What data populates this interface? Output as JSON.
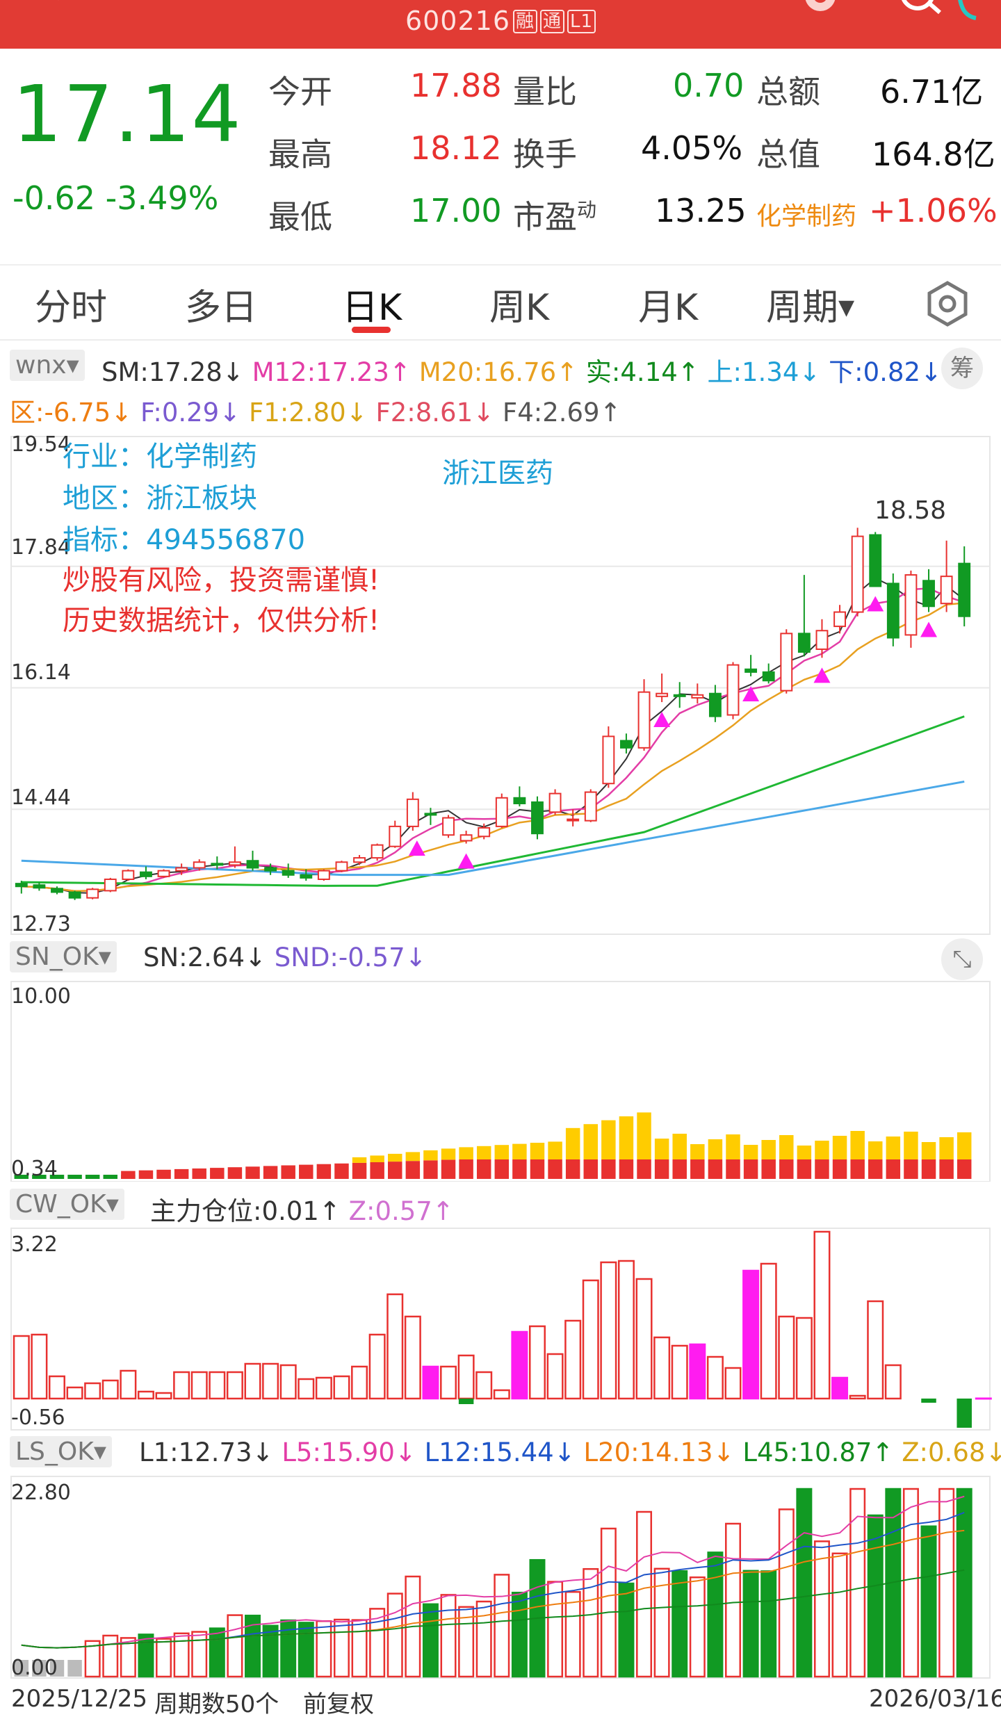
{
  "header": {
    "code": "600216",
    "tag1": "融",
    "tag2": "通",
    "tag3": "L1"
  },
  "quote": {
    "price": "17.14",
    "change": "-0.62",
    "change_pct": "-3.49%",
    "open_label": "今开",
    "open": "17.88",
    "high_label": "最高",
    "high": "18.12",
    "low_label": "最低",
    "low": "17.00",
    "vr_label": "量比",
    "vr": "0.70",
    "turn_label": "换手",
    "turn": "4.05%",
    "pe_label": "市盈",
    "pe_sup": "动",
    "pe": "13.25",
    "amt_label": "总额",
    "amt": "6.71亿",
    "cap_label": "总值",
    "cap": "164.8亿",
    "sector": "化学制药",
    "sector_pct": "+1.06%"
  },
  "tabs": [
    "分时",
    "多日",
    "日K",
    "周K",
    "月K",
    "周期"
  ],
  "active_tab": 2,
  "main_panel": {
    "name": "wnx",
    "chip": "筹",
    "line1": [
      "SM:17.28↓",
      "M12:17.23↑",
      "M20:16.76↑",
      "实:4.14↑",
      "上:1.34↓",
      "下:0.82↓"
    ],
    "line2": [
      "区:-6.75↓",
      "F:0.29↓",
      "F1:2.80↓",
      "F2:8.61↓",
      "F4:2.69↑"
    ],
    "axis": [
      "19.54",
      "17.84",
      "16.14",
      "14.44",
      "12.73"
    ],
    "ann_industry": "行业：化学制药",
    "ann_region": "地区：浙江板块",
    "ann_index": "指标：494556870",
    "ann_warn1": "炒股有风险，投资需谨慎!",
    "ann_warn2": "历史数据统计，仅供分析!",
    "ann_concept": "浙江医药",
    "high_label": "18.58"
  },
  "sn_panel": {
    "name": "SN_OK",
    "line": [
      "SN:2.64↓",
      "SND:-0.57↓"
    ],
    "axis_top": "10.00",
    "axis_bot": "0.34"
  },
  "cw_panel": {
    "name": "CW_OK",
    "line": [
      "主力仓位:0.01↑",
      "Z:0.57↑"
    ],
    "axis_top": "3.22",
    "axis_bot": "-0.56"
  },
  "ls_panel": {
    "name": "LS_OK",
    "line": [
      "L1:12.73↓",
      "L5:15.90↓",
      "L12:15.44↓",
      "L20:14.13↓",
      "L45:10.87↑",
      "Z:0.68↓"
    ],
    "axis_top": "22.80",
    "axis_bot": "0.00"
  },
  "footer": {
    "start_date": "2025/12/25",
    "period_count": "周期数50个",
    "adjust": "前复权",
    "end_date": "2026/03/16"
  },
  "colors": {
    "up": "#e8312f",
    "down": "#119a23",
    "header": "#e13b34",
    "magenta": "#ff1cf0",
    "gold": "#ffcc00"
  },
  "chart_data": {
    "type": "candlestick",
    "ylim": [
      12.73,
      19.54
    ],
    "candles": [
      [
        13.4,
        13.44,
        13.26,
        13.36
      ],
      [
        13.38,
        13.42,
        13.3,
        13.34
      ],
      [
        13.33,
        13.36,
        13.25,
        13.28
      ],
      [
        13.28,
        13.3,
        13.17,
        13.2
      ],
      [
        13.2,
        13.34,
        13.18,
        13.32
      ],
      [
        13.3,
        13.48,
        13.28,
        13.46
      ],
      [
        13.46,
        13.6,
        13.44,
        13.58
      ],
      [
        13.56,
        13.64,
        13.46,
        13.5
      ],
      [
        13.5,
        13.6,
        13.48,
        13.58
      ],
      [
        13.58,
        13.68,
        13.52,
        13.62
      ],
      [
        13.62,
        13.74,
        13.58,
        13.7
      ],
      [
        13.68,
        13.78,
        13.6,
        13.66
      ],
      [
        13.66,
        13.92,
        13.62,
        13.7
      ],
      [
        13.72,
        13.86,
        13.58,
        13.62
      ],
      [
        13.62,
        13.68,
        13.52,
        13.58
      ],
      [
        13.58,
        13.68,
        13.48,
        13.52
      ],
      [
        13.52,
        13.6,
        13.44,
        13.48
      ],
      [
        13.46,
        13.6,
        13.44,
        13.58
      ],
      [
        13.58,
        13.72,
        13.56,
        13.7
      ],
      [
        13.7,
        13.8,
        13.66,
        13.76
      ],
      [
        13.76,
        13.96,
        13.72,
        13.94
      ],
      [
        13.92,
        14.28,
        13.9,
        14.2
      ],
      [
        14.2,
        14.68,
        14.14,
        14.58
      ],
      [
        14.38,
        14.46,
        14.22,
        14.36
      ],
      [
        14.08,
        14.36,
        14.04,
        14.32
      ],
      [
        14.0,
        14.14,
        13.96,
        14.08
      ],
      [
        14.06,
        14.24,
        14.02,
        14.18
      ],
      [
        14.2,
        14.66,
        14.18,
        14.6
      ],
      [
        14.6,
        14.76,
        14.48,
        14.52
      ],
      [
        14.54,
        14.62,
        14.02,
        14.1
      ],
      [
        14.4,
        14.72,
        14.36,
        14.66
      ],
      [
        14.3,
        14.44,
        14.2,
        14.3
      ],
      [
        14.28,
        14.72,
        14.26,
        14.68
      ],
      [
        14.8,
        15.6,
        14.74,
        15.46
      ],
      [
        15.4,
        15.5,
        15.22,
        15.3
      ],
      [
        15.3,
        16.26,
        15.26,
        16.08
      ],
      [
        16.02,
        16.34,
        15.94,
        16.06
      ],
      [
        16.04,
        16.22,
        15.86,
        16.02
      ],
      [
        16.0,
        16.2,
        15.92,
        16.04
      ],
      [
        16.06,
        16.18,
        15.66,
        15.74
      ],
      [
        15.76,
        16.5,
        15.7,
        16.46
      ],
      [
        16.4,
        16.6,
        16.3,
        16.36
      ],
      [
        16.36,
        16.48,
        16.2,
        16.24
      ],
      [
        16.1,
        16.96,
        16.06,
        16.9
      ],
      [
        16.9,
        17.72,
        16.58,
        16.64
      ],
      [
        16.68,
        17.1,
        16.56,
        16.94
      ],
      [
        17.0,
        17.3,
        16.9,
        17.2
      ],
      [
        17.2,
        18.38,
        17.14,
        18.26
      ],
      [
        18.28,
        18.32,
        17.56,
        17.56
      ],
      [
        17.6,
        17.74,
        16.72,
        16.84
      ],
      [
        16.88,
        17.78,
        16.7,
        17.72
      ],
      [
        17.64,
        17.8,
        17.2,
        17.28
      ],
      [
        17.32,
        18.2,
        17.2,
        17.7
      ],
      [
        17.88,
        18.12,
        17.0,
        17.14
      ]
    ]
  }
}
